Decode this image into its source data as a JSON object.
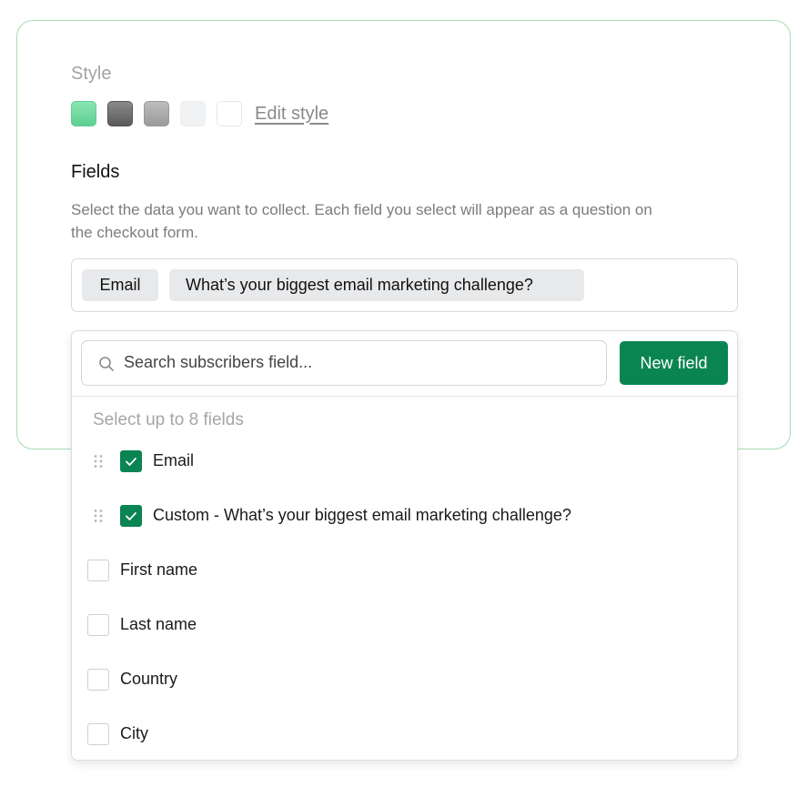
{
  "style": {
    "label": "Style",
    "swatches": [
      {
        "name": "green",
        "color": "#6fd89e"
      },
      {
        "name": "dark-gray",
        "color": "#6b6b6b"
      },
      {
        "name": "gray",
        "color": "#ababab"
      },
      {
        "name": "light-gray",
        "color": "#f1f2f3"
      },
      {
        "name": "white",
        "color": "#ffffff"
      }
    ],
    "edit_link": "Edit style"
  },
  "fields": {
    "title": "Fields",
    "description": "Select the data you want to collect. Each field you select will appear as a question on the checkout form.",
    "selected_chips": [
      "Email",
      "What’s your biggest email marketing challenge?"
    ]
  },
  "dropdown": {
    "search_placeholder": "Search subscribers field...",
    "new_field_label": "New field",
    "hint": "Select up to 8 fields",
    "options": [
      {
        "label": "Email",
        "checked": true,
        "draggable": true
      },
      {
        "label": "Custom - What’s your biggest email marketing challenge?",
        "checked": true,
        "draggable": true
      },
      {
        "label": "First name",
        "checked": false,
        "draggable": false
      },
      {
        "label": "Last name",
        "checked": false,
        "draggable": false
      },
      {
        "label": "Country",
        "checked": false,
        "draggable": false
      },
      {
        "label": "City",
        "checked": false,
        "draggable": false
      }
    ]
  },
  "colors": {
    "accent": "#0a8552",
    "card_border": "#a7dcb1"
  }
}
